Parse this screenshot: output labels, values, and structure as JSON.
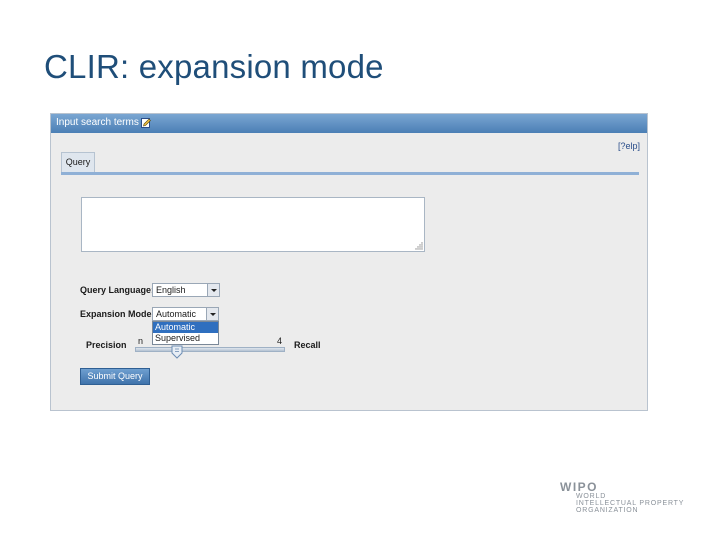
{
  "slide": {
    "title": "CLIR: expansion mode"
  },
  "panel": {
    "title": "Input search terms",
    "edit_icon": "edit-icon",
    "help_link": "[?elp]"
  },
  "tabs": [
    {
      "label": "Query",
      "active": true
    }
  ],
  "query": {
    "text": "",
    "placeholder": ""
  },
  "query_language": {
    "label": "Query Language:",
    "selected": "English"
  },
  "expansion_mode": {
    "label": "Expansion Mode:",
    "selected": "Automatic",
    "options": [
      "Automatic",
      "Supervised"
    ],
    "highlighted_option": "Automatic",
    "open": true
  },
  "slider": {
    "left_label": "Precision",
    "right_label": "Recall",
    "min_label": "n",
    "max_label": "4",
    "value_fraction": 0.28
  },
  "submit": {
    "label": "Submit Query"
  },
  "logo": {
    "word": "WIPO",
    "line1": "WORLD",
    "line2": "INTELLECTUAL PROPERTY",
    "line3": "ORGANIZATION"
  },
  "colors": {
    "title_blue": "#1f4e79",
    "header_blue": "#4b7fb5",
    "highlight_blue": "#2f6fbf",
    "logo_gray": "#8a9199"
  }
}
